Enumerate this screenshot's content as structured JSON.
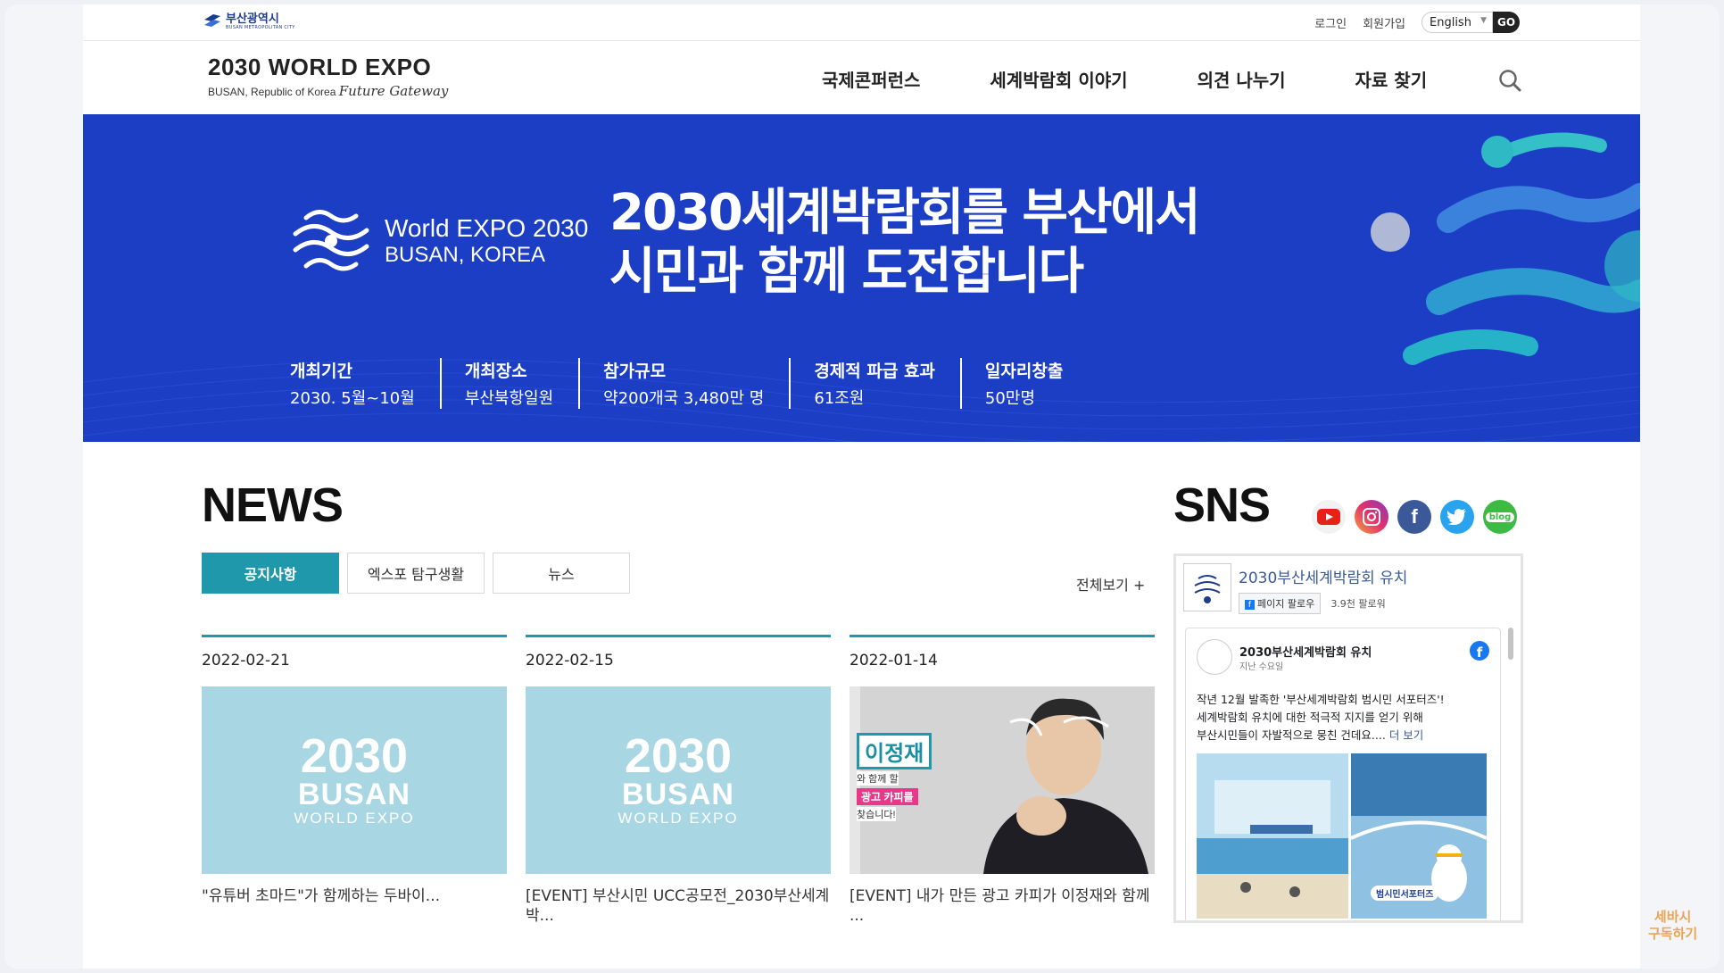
{
  "city": {
    "name": "부산광역시",
    "sub": "BUSAN METROPOLITAN CITY"
  },
  "util": {
    "login": "로그인",
    "signup": "회원가입",
    "lang": "English",
    "go": "GO"
  },
  "site": {
    "title": "2030 WORLD EXPO",
    "sub": "BUSAN, Republic of Korea",
    "slogan": "Future Gateway"
  },
  "nav": {
    "items": [
      "국제콘퍼런스",
      "세계박람회 이야기",
      "의견 나누기",
      "자료 찾기"
    ]
  },
  "hero": {
    "logo_line1": "World EXPO 2030",
    "logo_line2": "BUSAN, KOREA",
    "title_line1": "2030세계박람회를 부산에서",
    "title_line2": "시민과 함께 도전합니다",
    "facts": [
      {
        "key": "개최기간",
        "value": "2030. 5월~10월"
      },
      {
        "key": "개최장소",
        "value": "부산북항일원"
      },
      {
        "key": "참가규모",
        "value": "약200개국 3,480만 명"
      },
      {
        "key": "경제적 파급 효과",
        "value": "61조원"
      },
      {
        "key": "일자리창출",
        "value": "50만명"
      }
    ]
  },
  "news": {
    "title": "NEWS",
    "tabs": [
      "공지사항",
      "엑스포 탐구생활",
      "뉴스"
    ],
    "view_all": "전체보기 +",
    "thumb": {
      "year": "2030",
      "city": "BUSAN",
      "expo": "WORLD EXPO"
    },
    "cards": [
      {
        "date": "2022-02-21",
        "caption": "\"유튜버 초마드\"가 함께하는 두바이..."
      },
      {
        "date": "2022-02-15",
        "caption": "[EVENT] 부산시민 UCC공모전_2030부산세계박..."
      },
      {
        "date": "2022-01-14",
        "caption": "[EVENT] 내가 만든 광고 카피가 이정재와 함께 ..."
      }
    ],
    "photo_text": {
      "name": "이정재",
      "line": "와 함께 할",
      "copy": "광고 카피를",
      "end": "찾습니다!"
    }
  },
  "sns": {
    "title": "SNS",
    "icons": [
      "youtube-icon",
      "instagram-icon",
      "facebook-icon",
      "twitter-icon",
      "blog-icon"
    ],
    "blog_label": "blog",
    "fb": {
      "page_name": "2030부산세계박람회 유치",
      "follow": "페이지 팔로우",
      "followers": "3.9천 팔로워",
      "post_author": "2030부산세계박람회 유치",
      "post_time": "지난 수요일",
      "post_line1": "작년 12월 발족한 '부산세계박람회 범시민 서포터즈'!",
      "post_line2": "세계박람회 유치에 대한 적극적 지지를 얻기 위해",
      "post_line3": "부산시민들이 자발적으로 뭉친 건데요....",
      "more": "더 보기",
      "img2_label": "범시민서포터즈"
    }
  },
  "overlay": {
    "line1": "세바시",
    "line2": "구독하기"
  }
}
